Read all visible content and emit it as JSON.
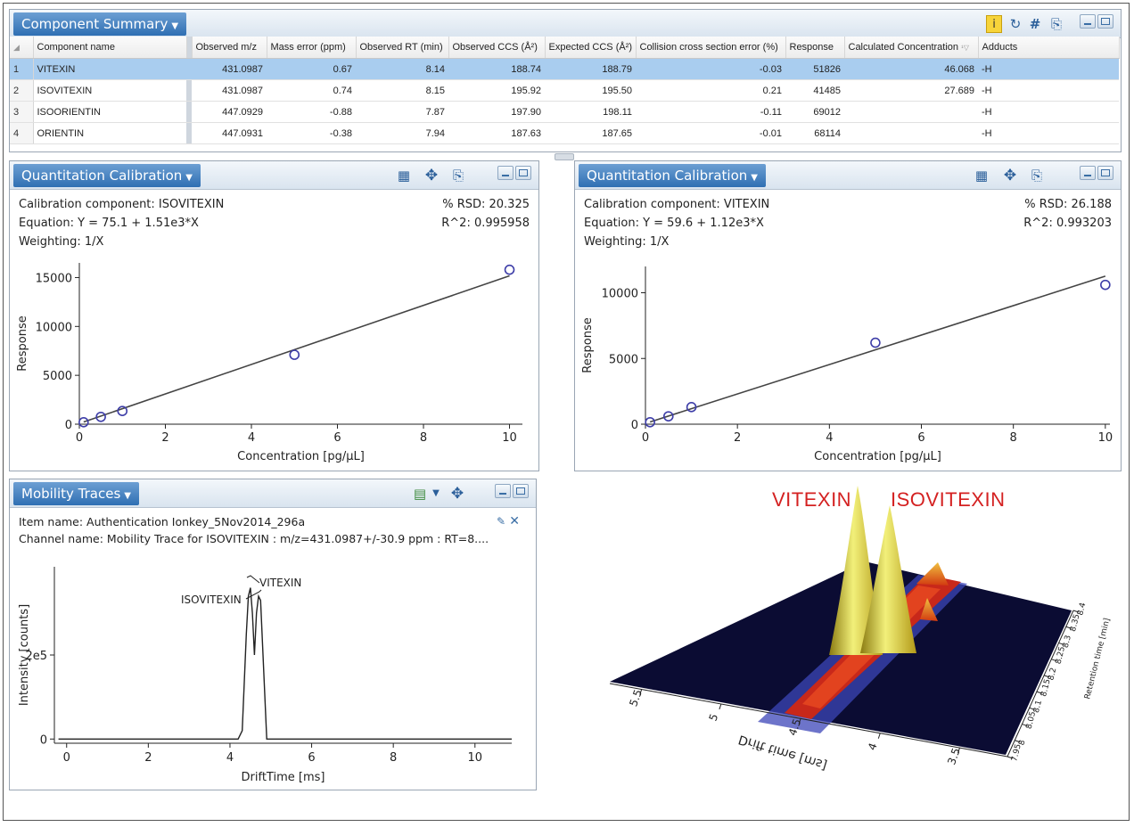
{
  "component_summary": {
    "title": "Component Summary",
    "columns": [
      "Component name",
      "Observed m/z",
      "Mass error (ppm)",
      "Observed RT (min)",
      "Observed CCS (Å²)",
      "Expected CCS (Å²)",
      "Collision cross section error (%)",
      "Response",
      "Calculated Concentration",
      "Adducts"
    ],
    "rows": [
      {
        "n": "1",
        "name": "VITEXIN",
        "mz": "431.0987",
        "err": "0.67",
        "rt": "8.14",
        "occs": "188.74",
        "eccs": "188.79",
        "ccserr": "-0.03",
        "resp": "51826",
        "conc": "46.068",
        "add": "-H",
        "selected": true
      },
      {
        "n": "2",
        "name": "ISOVITEXIN",
        "mz": "431.0987",
        "err": "0.74",
        "rt": "8.15",
        "occs": "195.92",
        "eccs": "195.50",
        "ccserr": "0.21",
        "resp": "41485",
        "conc": "27.689",
        "add": "-H",
        "selected": false
      },
      {
        "n": "3",
        "name": "ISOORIENTIN",
        "mz": "447.0929",
        "err": "-0.88",
        "rt": "7.87",
        "occs": "197.90",
        "eccs": "198.11",
        "ccserr": "-0.11",
        "resp": "69012",
        "conc": "",
        "add": "-H",
        "selected": false
      },
      {
        "n": "4",
        "name": "ORIENTIN",
        "mz": "447.0931",
        "err": "-0.38",
        "rt": "7.94",
        "occs": "187.63",
        "eccs": "187.65",
        "ccserr": "-0.01",
        "resp": "68114",
        "conc": "",
        "add": "-H",
        "selected": false
      }
    ]
  },
  "cal_left": {
    "title": "Quantitation Calibration",
    "component": "Calibration component: ISOVITEXIN",
    "equation": "Equation: Y = 75.1 + 1.51e3*X",
    "weighting": "Weighting: 1/X",
    "rsd": "% RSD: 20.325",
    "r2": "R^2: 0.995958",
    "xlabel": "Concentration [pg/µL]",
    "ylabel": "Response"
  },
  "cal_right": {
    "title": "Quantitation Calibration",
    "component": "Calibration component: VITEXIN",
    "equation": "Equation: Y = 59.6 + 1.12e3*X",
    "weighting": "Weighting: 1/X",
    "rsd": "% RSD: 26.188",
    "r2": "R^2: 0.993203",
    "xlabel": "Concentration [pg/µL]",
    "ylabel": "Response"
  },
  "mobility": {
    "title": "Mobility Traces",
    "item_name": "Item name: Authentication Ionkey_5Nov2014_296a",
    "channel_name": "Channel name: Mobility Trace for ISOVITEXIN : m/z=431.0987+/-30.9 ppm : RT=8....",
    "xlabel": "DriftTime [ms]",
    "ylabel": "Intensity [counts]",
    "peak_labels": [
      "VITEXIN",
      "ISOVITEXIN"
    ]
  },
  "surface": {
    "label_left": "VITEXIN",
    "label_right": "ISOVITEXIN",
    "drift_axis_label": "Drift time [ms]",
    "rt_axis_label": "Retention time [min]",
    "drift_ticks": [
      "5.5",
      "5",
      "4.5",
      "4",
      "3.5"
    ],
    "rt_ticks": [
      "7.95",
      "8",
      "8.05",
      "8.1",
      "8.15",
      "8.2",
      "8.25",
      "8.3",
      "8.35",
      "8.4"
    ]
  },
  "chart_data": [
    {
      "type": "scatter",
      "title": "Calibration component: ISOVITEXIN",
      "xlabel": "Concentration [pg/µL]",
      "ylabel": "Response",
      "xlim": [
        0,
        10.3
      ],
      "ylim": [
        0,
        16500
      ],
      "xticks": [
        0,
        2,
        4,
        6,
        8,
        10
      ],
      "yticks": [
        0,
        5000,
        10000,
        15000
      ],
      "points": [
        [
          0.1,
          200
        ],
        [
          0.5,
          750
        ],
        [
          1,
          1350
        ],
        [
          5,
          7100
        ],
        [
          10,
          15800
        ]
      ],
      "fit": {
        "intercept": 75.1,
        "slope": 1510
      }
    },
    {
      "type": "scatter",
      "title": "Calibration component: VITEXIN",
      "xlabel": "Concentration [pg/µL]",
      "ylabel": "Response",
      "xlim": [
        0,
        10.1
      ],
      "ylim": [
        0,
        12000
      ],
      "xticks": [
        0,
        2,
        4,
        6,
        8,
        10
      ],
      "yticks": [
        0,
        5000,
        10000
      ],
      "points": [
        [
          0.1,
          150
        ],
        [
          0.5,
          600
        ],
        [
          1,
          1300
        ],
        [
          5,
          6200
        ],
        [
          10,
          10600
        ]
      ],
      "fit": {
        "intercept": 59.6,
        "slope": 1120
      }
    },
    {
      "type": "line",
      "title": "Mobility Traces",
      "xlabel": "DriftTime [ms]",
      "ylabel": "Intensity [counts]",
      "xlim": [
        -0.3,
        10.9
      ],
      "ylim": [
        -10000.0,
        410000.0
      ],
      "xticks": [
        0,
        2,
        4,
        6,
        8,
        10
      ],
      "yticks": [
        0,
        200000
      ],
      "ytick_labels": [
        "0",
        "2e5"
      ],
      "x": [
        -0.2,
        4.2,
        4.3,
        4.4,
        4.45,
        4.5,
        4.55,
        4.6,
        4.65,
        4.7,
        4.75,
        4.8,
        4.9,
        10.9
      ],
      "y": [
        0,
        0,
        20000,
        250000,
        340000,
        360000,
        300000,
        200000,
        300000,
        340000,
        330000,
        220000,
        0,
        0
      ]
    }
  ]
}
